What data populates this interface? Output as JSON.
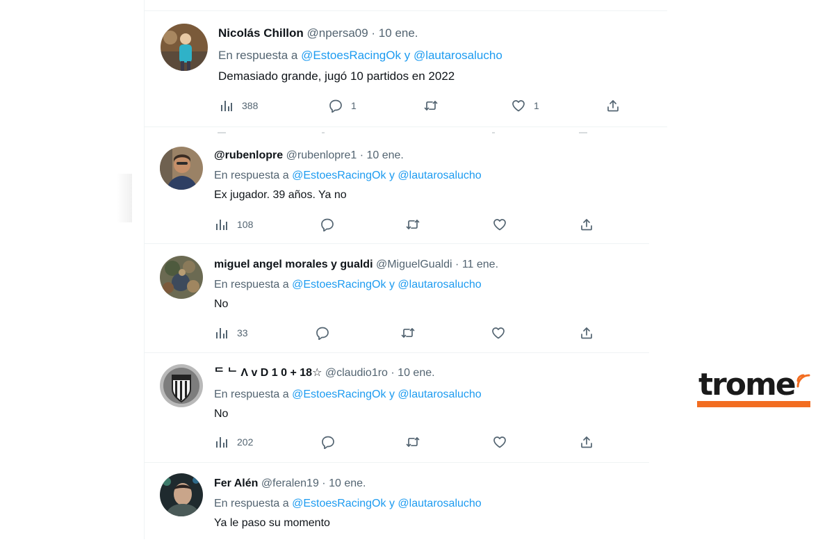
{
  "tweets": [
    {
      "display_name": "Nicolás Chillon",
      "handle": "@npersa09",
      "date": "· 10 ene.",
      "reply_prefix": "En respuesta a",
      "mention1": "@EstoesRacingOk",
      "conj": "y",
      "mention2": "@lautarosalucho",
      "text": "Demasiado grande, jugó 10 partidos en 2022",
      "views": "388",
      "replies": "1",
      "retweets": "",
      "likes": "1",
      "avatar_icon": "avatar-photo"
    },
    {
      "display_name": "@rubenlopre",
      "handle": "@rubenlopre1",
      "date": "· 10 ene.",
      "reply_prefix": "En respuesta a",
      "mention1": "@EstoesRacingOk",
      "conj": "y",
      "mention2": "@lautarosalucho",
      "text": "Ex jugador.  39 años. Ya no",
      "views": "108",
      "replies": "",
      "retweets": "",
      "likes": "",
      "avatar_icon": "avatar-photo"
    },
    {
      "display_name": "miguel angel morales y gualdi",
      "handle": "@MiguelGualdi",
      "date": "· 11 ene.",
      "reply_prefix": "En respuesta a",
      "mention1": "@EstoesRacingOk",
      "conj": "y",
      "mention2": "@lautarosalucho",
      "text": "No",
      "views": "33",
      "replies": "",
      "retweets": "",
      "likes": "",
      "avatar_icon": "avatar-photo"
    },
    {
      "display_name": "ᄃ ᄂ Λ v D 1 0 + 18☆",
      "handle": "@claudio1ro",
      "date": "· 10 ene.",
      "reply_prefix": "En respuesta a",
      "mention1": "@EstoesRacingOk",
      "conj": "y",
      "mention2": "@lautarosalucho",
      "text": "No",
      "views": "202",
      "replies": "",
      "retweets": "",
      "likes": "",
      "avatar_icon": "avatar-club-crest"
    },
    {
      "display_name": "Fer Alén",
      "handle": "@feralen19",
      "date": "· 10 ene.",
      "reply_prefix": "En respuesta a",
      "mention1": "@EstoesRacingOk",
      "conj": "y",
      "mention2": "@lautarosalucho",
      "text": "Ya le paso su momento",
      "avatar_icon": "avatar-photo"
    }
  ],
  "icons": {
    "views": "views-chart-icon",
    "reply": "reply-bubble-icon",
    "retweet": "retweet-icon",
    "like": "heart-icon",
    "share": "share-upload-icon"
  },
  "colors": {
    "link": "#1d9bf0",
    "muted": "#536471",
    "text": "#0f1419",
    "divider": "#eff3f4",
    "brand_orange": "#f26d21"
  },
  "watermark": {
    "brand": "trome"
  }
}
